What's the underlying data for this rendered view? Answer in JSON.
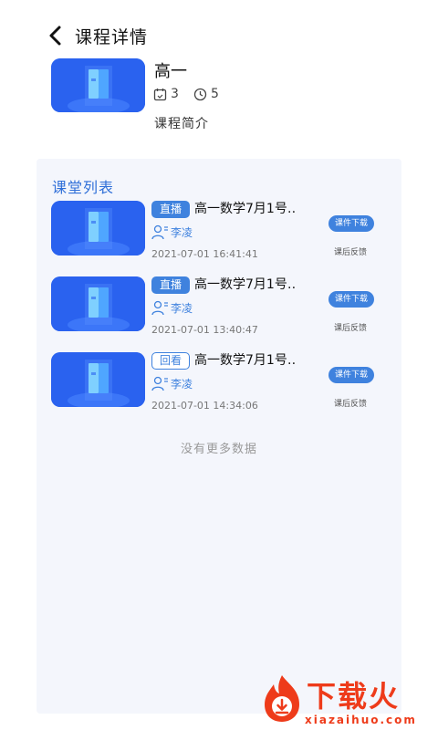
{
  "header": {
    "title": "课程详情",
    "back_icon": "chevron-left-icon"
  },
  "course": {
    "name": "高一",
    "lesson_count": "3",
    "hours": "5",
    "intro_label": "课程简介",
    "cover_icon": "book-icon"
  },
  "list": {
    "title": "课堂列表",
    "items": [
      {
        "tag": "直播",
        "tag_type": "live",
        "title": "高一数学7月1号…",
        "teacher": "李凌",
        "time": "2021-07-01 16:41:41",
        "download_label": "课件下载",
        "feedback_label": "课后反馈"
      },
      {
        "tag": "直播",
        "tag_type": "live",
        "title": "高一数学7月1号…",
        "teacher": "李凌",
        "time": "2021-07-01 13:40:47",
        "download_label": "课件下载",
        "feedback_label": "课后反馈"
      },
      {
        "tag": "回看",
        "tag_type": "replay",
        "title": "高一数学7月1号…",
        "teacher": "李凌",
        "time": "2021-07-01 14:34:06",
        "download_label": "课件下载",
        "feedback_label": "课后反馈"
      }
    ],
    "no_more": "没有更多数据"
  },
  "watermark": {
    "brand": "下载火",
    "url": "xiazaihuo.com"
  },
  "colors": {
    "accent": "#3f82de",
    "panel": "#f4f6fc",
    "watermark": "#ee3b1a"
  }
}
